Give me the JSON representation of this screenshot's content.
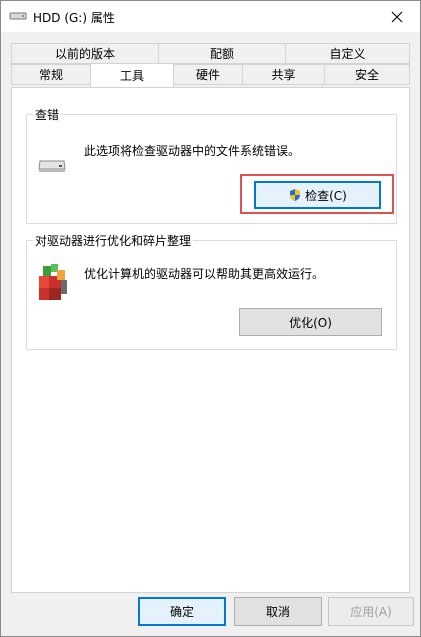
{
  "window": {
    "title": "HDD (G:) 属性",
    "close_icon": "close-icon",
    "drive_icon": "drive-icon"
  },
  "tabs": {
    "row1": [
      {
        "label": "以前的版本"
      },
      {
        "label": "配额"
      },
      {
        "label": "自定义"
      }
    ],
    "row2": [
      {
        "label": "常规"
      },
      {
        "label": "工具"
      },
      {
        "label": "硬件"
      },
      {
        "label": "共享"
      },
      {
        "label": "安全"
      }
    ],
    "active": "工具"
  },
  "error_check": {
    "heading": "查错",
    "description": "此选项将检查驱动器中的文件系统错误。",
    "button_label": "检查(C)",
    "icon": "drive-icon",
    "button_icon": "uac-shield-icon"
  },
  "optimize": {
    "heading": "对驱动器进行优化和碎片整理",
    "description": "优化计算机的驱动器可以帮助其更高效运行。",
    "button_label": "优化(O)",
    "icon": "defrag-icon"
  },
  "footer": {
    "ok_label": "确定",
    "cancel_label": "取消",
    "apply_label": "应用(A)"
  },
  "colors": {
    "focus_blue": "#0078d7",
    "highlight_red": "#e0524f"
  }
}
